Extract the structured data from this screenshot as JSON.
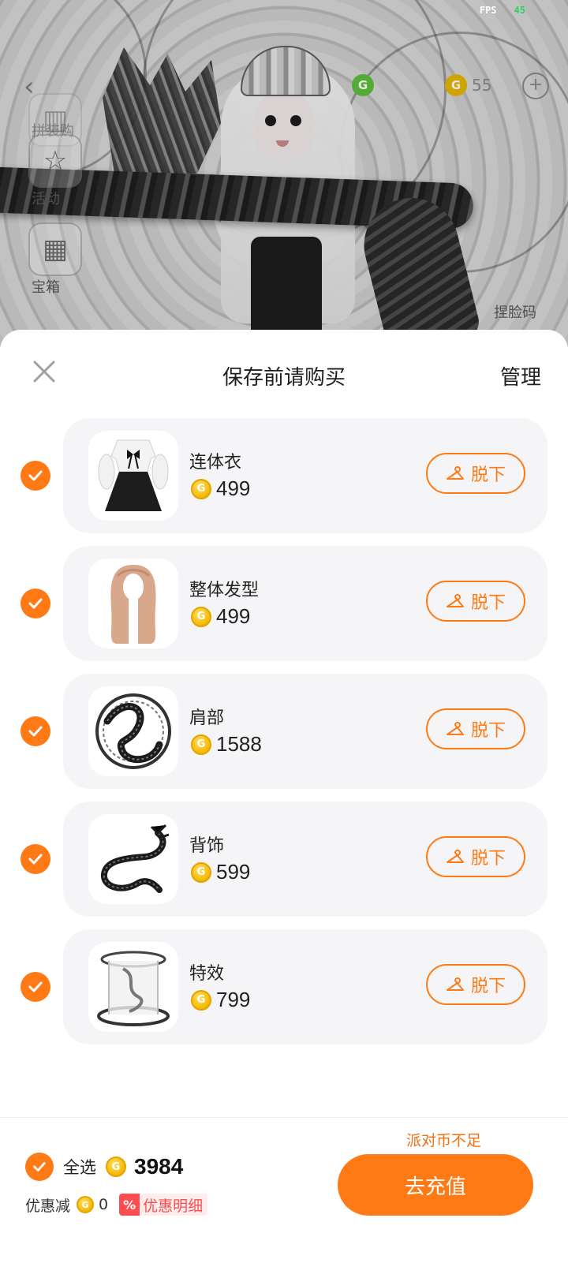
{
  "status": {
    "fps_label": "FPS",
    "fps_value": "45"
  },
  "background": {
    "side_buttons": [
      {
        "label": "拼装购",
        "icon": "bag-icon"
      },
      {
        "label": "活动",
        "icon": "star-icon"
      },
      {
        "label": "宝箱",
        "icon": "gift-icon"
      }
    ],
    "pinch_code_label": "捏脸码",
    "currency_value": "55"
  },
  "sheet": {
    "title": "保存前请购买",
    "manage_label": "管理",
    "close_icon": "close-icon",
    "items": [
      {
        "name": "连体衣",
        "price": "499",
        "action": "脱下",
        "selected": true,
        "thumb": "dress"
      },
      {
        "name": "整体发型",
        "price": "499",
        "action": "脱下",
        "selected": true,
        "thumb": "hair"
      },
      {
        "name": "肩部",
        "price": "1588",
        "action": "脱下",
        "selected": true,
        "thumb": "shoulder"
      },
      {
        "name": "背饰",
        "price": "599",
        "action": "脱下",
        "selected": true,
        "thumb": "back"
      },
      {
        "name": "特效",
        "price": "799",
        "action": "脱下",
        "selected": true,
        "thumb": "effect"
      }
    ]
  },
  "footer": {
    "insufficient_text": "派对币不足",
    "select_all_label": "全选",
    "total": "3984",
    "discount_label": "优惠减",
    "discount_value": "0",
    "promo_percent": "%",
    "promo_detail_label": "优惠明细",
    "recharge_label": "去充值"
  },
  "colors": {
    "accent": "#ff7a14",
    "coin": "#f5b800",
    "promo": "#ff4d4f",
    "card": "#f5f5f8"
  }
}
